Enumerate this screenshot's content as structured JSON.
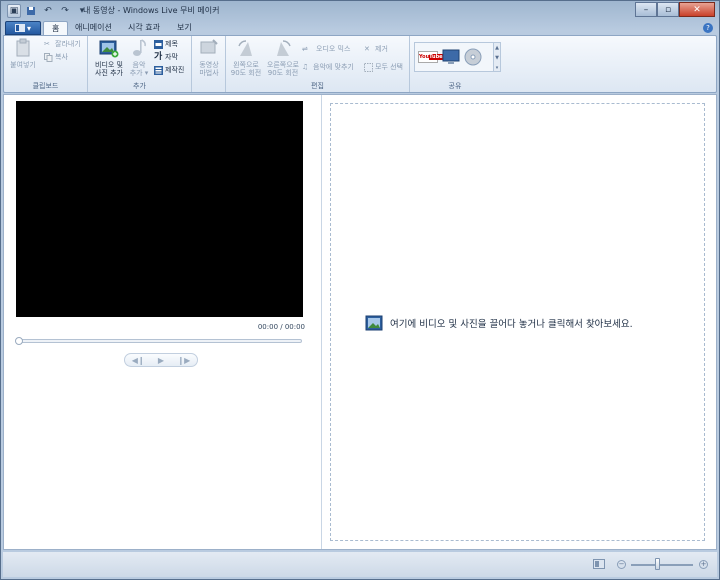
{
  "window": {
    "title": "내 동영상 - Windows Live 무비 메이커"
  },
  "tabs": {
    "file_icon": "movie-maker-menu-icon",
    "home": "홈",
    "animations": "애니메이션",
    "visual_effects": "시각 효과",
    "view": "보기"
  },
  "ribbon": {
    "clipboard": {
      "label": "클립보드",
      "paste": "붙여넣기",
      "cut": "잘라내기",
      "copy": "복사"
    },
    "add": {
      "label": "추가",
      "add_videos_line1": "비디오 및",
      "add_videos_line2": "사진 추가",
      "add_music_line1": "음악",
      "add_music_line2": "추가 ▾",
      "title": "제목",
      "caption": "자막",
      "credits": "제작진"
    },
    "wizard": {
      "line1": "동영상",
      "line2": "마법사"
    },
    "editing": {
      "label": "편집",
      "rotate_left_line1": "왼쪽으로",
      "rotate_left_line2": "90도 회전",
      "rotate_right_line1": "오른쪽으로",
      "rotate_right_line2": "90도 회전",
      "audio_mix": "오디오 믹스",
      "fit_to_music": "음악에 맞추기",
      "remove": "제거",
      "select_all": "모두 선택"
    },
    "share": {
      "label": "공유"
    }
  },
  "preview": {
    "timecode": "00:00 / 00:00",
    "progress": 0
  },
  "storyboard": {
    "hint": "여기에 비디오 및 사진을 끌어다 놓거나 클릭해서 찾아보세요."
  },
  "colors": {
    "accent": "#2459a0",
    "video_bg": "#000000"
  }
}
